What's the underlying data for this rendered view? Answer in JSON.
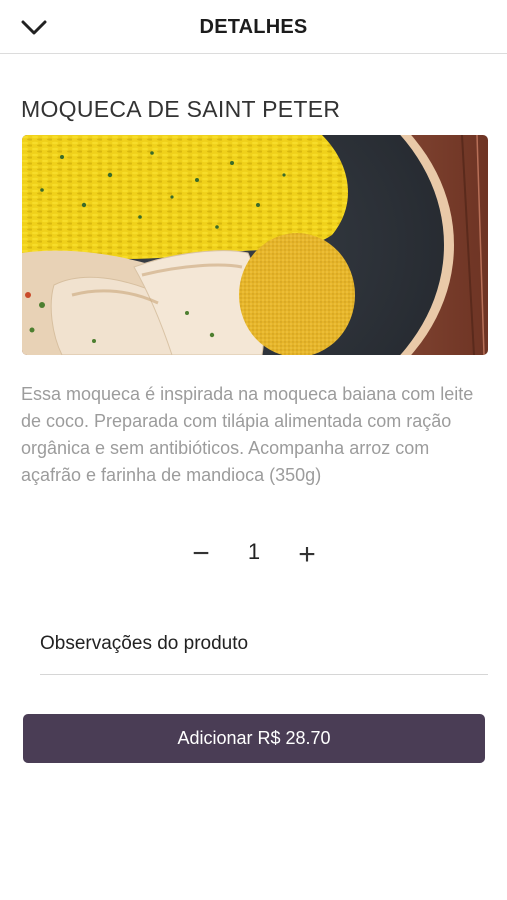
{
  "header": {
    "title": "DETALHES",
    "back_icon": "chevron-down-icon"
  },
  "product": {
    "name": "MOQUECA DE SAINT PETER",
    "image": "moqueca-dish-photo",
    "description": "Essa moqueca é inspirada na moqueca baiana com leite de coco. Preparada com tilápia alimentada com ração orgânica e sem antibióticos. Acompanha arroz com açafrão e farinha de mandioca (350g)"
  },
  "quantity": {
    "minus_label": "−",
    "value": "1",
    "plus_label": "+"
  },
  "notes": {
    "placeholder": "Observações do produto"
  },
  "add_button": {
    "label": "Adicionar R$ 28.70"
  },
  "colors": {
    "accent": "#4a3d55",
    "description_text": "#9c9c9c",
    "divider": "#dcdcdc"
  }
}
